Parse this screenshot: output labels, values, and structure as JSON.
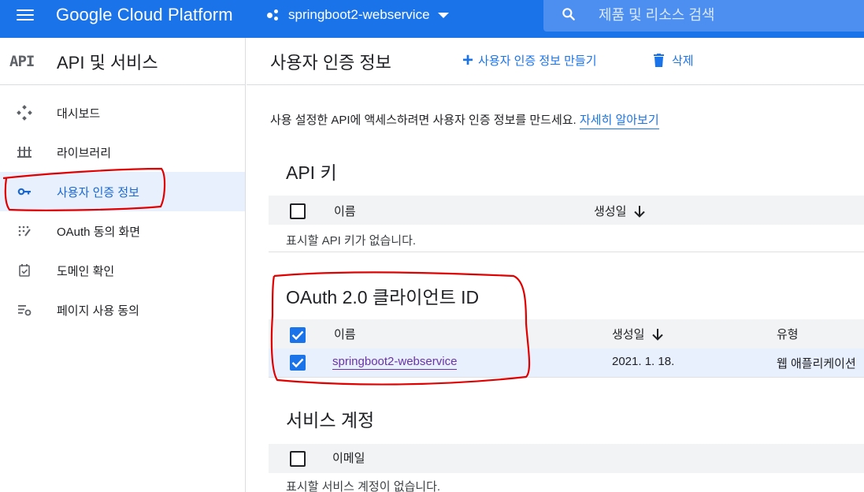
{
  "topbar": {
    "brand": "Google Cloud Platform",
    "project": "springboot2-webservice",
    "search_placeholder": "제품 및 리소스 검색"
  },
  "sidebar": {
    "logo": "API",
    "title": "API 및 서비스",
    "items": [
      {
        "label": "대시보드",
        "icon": "dashboard-icon"
      },
      {
        "label": "라이브러리",
        "icon": "library-icon"
      },
      {
        "label": "사용자 인증 정보",
        "icon": "key-icon",
        "active": true
      },
      {
        "label": "OAuth 동의 화면",
        "icon": "oauth-consent-icon"
      },
      {
        "label": "도메인 확인",
        "icon": "domain-check-icon"
      },
      {
        "label": "페이지 사용 동의",
        "icon": "page-usage-icon"
      }
    ]
  },
  "main": {
    "title": "사용자 인증 정보",
    "create_label": "사용자 인증 정보 만들기",
    "delete_label": "삭제",
    "intro_text": "사용 설정한 API에 액세스하려면 사용자 인증 정보를 만드세요. ",
    "intro_link": "자세히 알아보기",
    "api_keys": {
      "title": "API 키",
      "col_name": "이름",
      "col_created": "생성일",
      "empty": "표시할 API 키가 없습니다."
    },
    "oauth": {
      "title": "OAuth 2.0 클라이언트 ID",
      "col_name": "이름",
      "col_created": "생성일",
      "col_type": "유형",
      "rows": [
        {
          "name": "springboot2-webservice",
          "created": "2021. 1. 18.",
          "type": "웹 애플리케이션",
          "checked": true
        }
      ],
      "header_checked": true
    },
    "service_accounts": {
      "title": "서비스 계정",
      "col_email": "이메일",
      "empty": "표시할 서비스 계정이 없습니다."
    }
  },
  "colors": {
    "brand_blue": "#1a73e8",
    "annotation_red": "#e00000"
  }
}
